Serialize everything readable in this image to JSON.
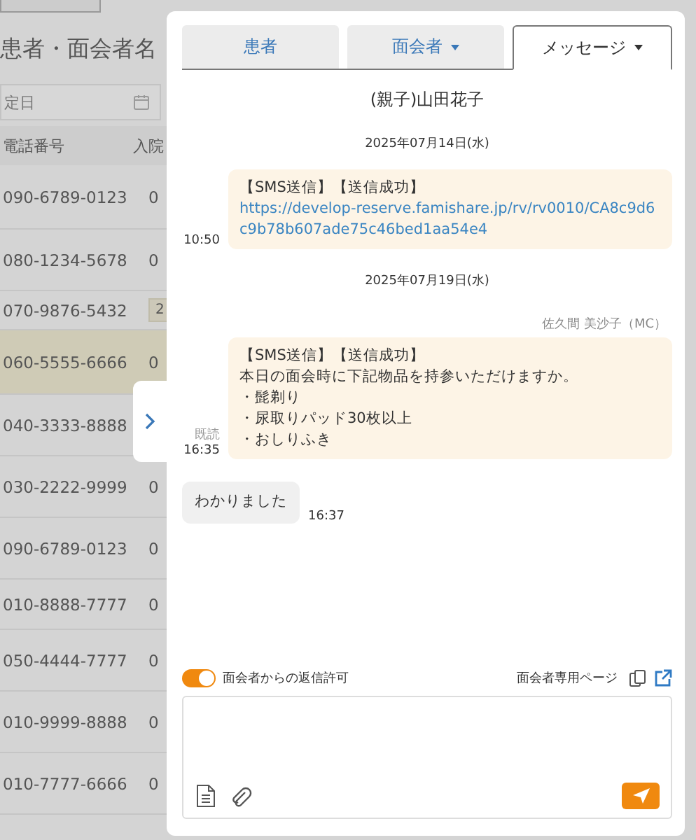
{
  "background_page": {
    "title": "患者・面会者名",
    "date_field": {
      "placeholder": "定日"
    },
    "columns": [
      "電話番号",
      "入院"
    ],
    "rows": [
      {
        "phone": "090-6789-0123",
        "column_2": "0",
        "kind": "text",
        "selected": false
      },
      {
        "phone": "080-1234-5678",
        "column_2": "0",
        "kind": "text",
        "selected": false
      },
      {
        "phone": "070-9876-5432",
        "column_2": "2",
        "kind": "badge",
        "selected": false
      },
      {
        "phone": "060-5555-6666",
        "column_2": "0",
        "kind": "text",
        "selected": true
      },
      {
        "phone": "040-3333-8888",
        "kind": "covered",
        "selected": false
      },
      {
        "phone": "030-2222-9999",
        "column_2": "0",
        "kind": "text",
        "selected": false
      },
      {
        "phone": "090-6789-0123",
        "column_2": "0",
        "kind": "text",
        "selected": false
      },
      {
        "phone": "010-8888-7777",
        "column_2": "0",
        "kind": "text",
        "selected": false
      },
      {
        "phone": "050-4444-7777",
        "column_2": "0",
        "kind": "text",
        "selected": false
      },
      {
        "phone": "010-9999-8888",
        "column_2": "0",
        "kind": "text",
        "selected": false
      },
      {
        "phone": "010-7777-6666",
        "column_2": "0",
        "kind": "text",
        "selected": false
      }
    ]
  },
  "panel": {
    "tabs": [
      {
        "label": "患者",
        "dropdown": false,
        "selected": false
      },
      {
        "label": "面会者",
        "dropdown": true,
        "selected": false
      },
      {
        "label": "メッセージ",
        "dropdown": true,
        "selected": true
      }
    ],
    "contact_name": "(親子)山田花子",
    "messages": [
      {
        "kind": "date",
        "text": "2025年07月14日(水)"
      },
      {
        "kind": "outgoing",
        "lines": [
          "【SMS送信】【送信成功】"
        ],
        "link": "https://develop-reserve.famishare.jp/rv/rv0010/CA8c9d6c9b78b607ade75c46bed1aa54e4",
        "time": "10:50"
      },
      {
        "kind": "date",
        "text": "2025年07月19日(水)"
      },
      {
        "kind": "outgoing",
        "sender": "佐久間 美沙子（MC）",
        "lines": [
          "【SMS送信】【送信成功】",
          "本日の面会時に下記物品を持参いただけますか。",
          "・髭剃り",
          "・尿取りパッド30枚以上",
          "・おしりふき"
        ],
        "read": "既読",
        "time": "16:35"
      },
      {
        "kind": "incoming",
        "text": "わかりました",
        "time": "16:37"
      }
    ],
    "reply_permission": {
      "label": "面会者からの返信許可",
      "on": true
    },
    "visitor_page_label": "面会者専用ページ"
  }
}
